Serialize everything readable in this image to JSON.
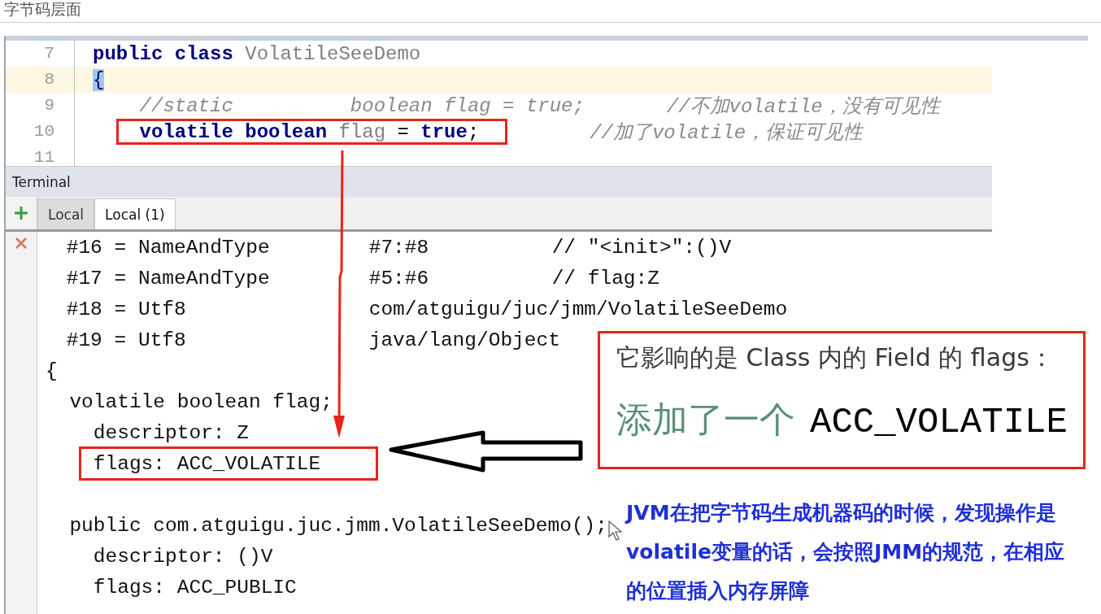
{
  "page_title": "字节码层面",
  "editor": {
    "lines": [
      {
        "number": "7",
        "highlighted": false,
        "boxed": false,
        "tokens": [
          {
            "kind": "keyword",
            "text": "public class "
          },
          {
            "kind": "name",
            "text": "VolatileSeeDemo"
          }
        ]
      },
      {
        "number": "8",
        "highlighted": true,
        "boxed": false,
        "tokens": [
          {
            "kind": "brace",
            "text": "{"
          }
        ]
      },
      {
        "number": "9",
        "highlighted": false,
        "boxed": false,
        "tokens": [
          {
            "kind": "comment",
            "text": "    //static          boolean flag = true;"
          },
          {
            "kind": "comment",
            "text": "       //不加volatile，没有可见性"
          }
        ]
      },
      {
        "number": "10",
        "highlighted": false,
        "boxed": true,
        "tokens": [
          {
            "kind": "keyword",
            "text": "    volatile boolean "
          },
          {
            "kind": "name",
            "text": "flag"
          },
          {
            "kind": "plain",
            "text": " = "
          },
          {
            "kind": "keyword",
            "text": "true"
          },
          {
            "kind": "plain",
            "text": ";"
          },
          {
            "kind": "comment",
            "text": "       //加了volatile，保证可见性"
          }
        ]
      },
      {
        "number": "11",
        "highlighted": false,
        "boxed": false
      }
    ]
  },
  "terminal": {
    "title": "Terminal",
    "tabs": [
      {
        "label": "Local",
        "selected": false
      },
      {
        "label": "Local (1)",
        "selected": true
      }
    ],
    "lines": [
      {
        "kind": "entry",
        "cells": [
          "#16 = NameAndType",
          "#7:#8",
          "// \"<init>\":()V"
        ]
      },
      {
        "kind": "entry",
        "cells": [
          "#17 = NameAndType",
          "#5:#6",
          "// flag:Z"
        ]
      },
      {
        "kind": "entry",
        "cells": [
          "#18 = Utf8",
          "com/atguigu/juc/jmm/VolatileSeeDemo"
        ]
      },
      {
        "kind": "entry",
        "cells": [
          "#19 = Utf8",
          "java/lang/Object"
        ]
      },
      {
        "kind": "text",
        "boxed": false,
        "text": "{"
      },
      {
        "kind": "text",
        "boxed": false,
        "text": "  volatile boolean flag;"
      },
      {
        "kind": "text",
        "boxed": false,
        "text": "    descriptor: Z"
      },
      {
        "kind": "text",
        "boxed": true,
        "text": "    flags: ACC_VOLATILE"
      },
      {
        "kind": "blank"
      },
      {
        "kind": "text",
        "boxed": false,
        "text": "  public com.atguigu.juc.jmm.VolatileSeeDemo();"
      },
      {
        "kind": "text",
        "boxed": false,
        "text": "    descriptor: ()V"
      },
      {
        "kind": "text",
        "boxed": false,
        "text": "    flags: ACC_PUBLIC"
      }
    ]
  },
  "callout": {
    "heading": "它影响的是 Class 内的 Field 的 flags：",
    "prefix": "添加了一个",
    "value": "ACC_VOLATILE"
  },
  "note": "JVM在把字节码生成机器码的时候，发现操作是volatile变量的话，会按照JMM的规范，在相应的位置插入内存屏障"
}
